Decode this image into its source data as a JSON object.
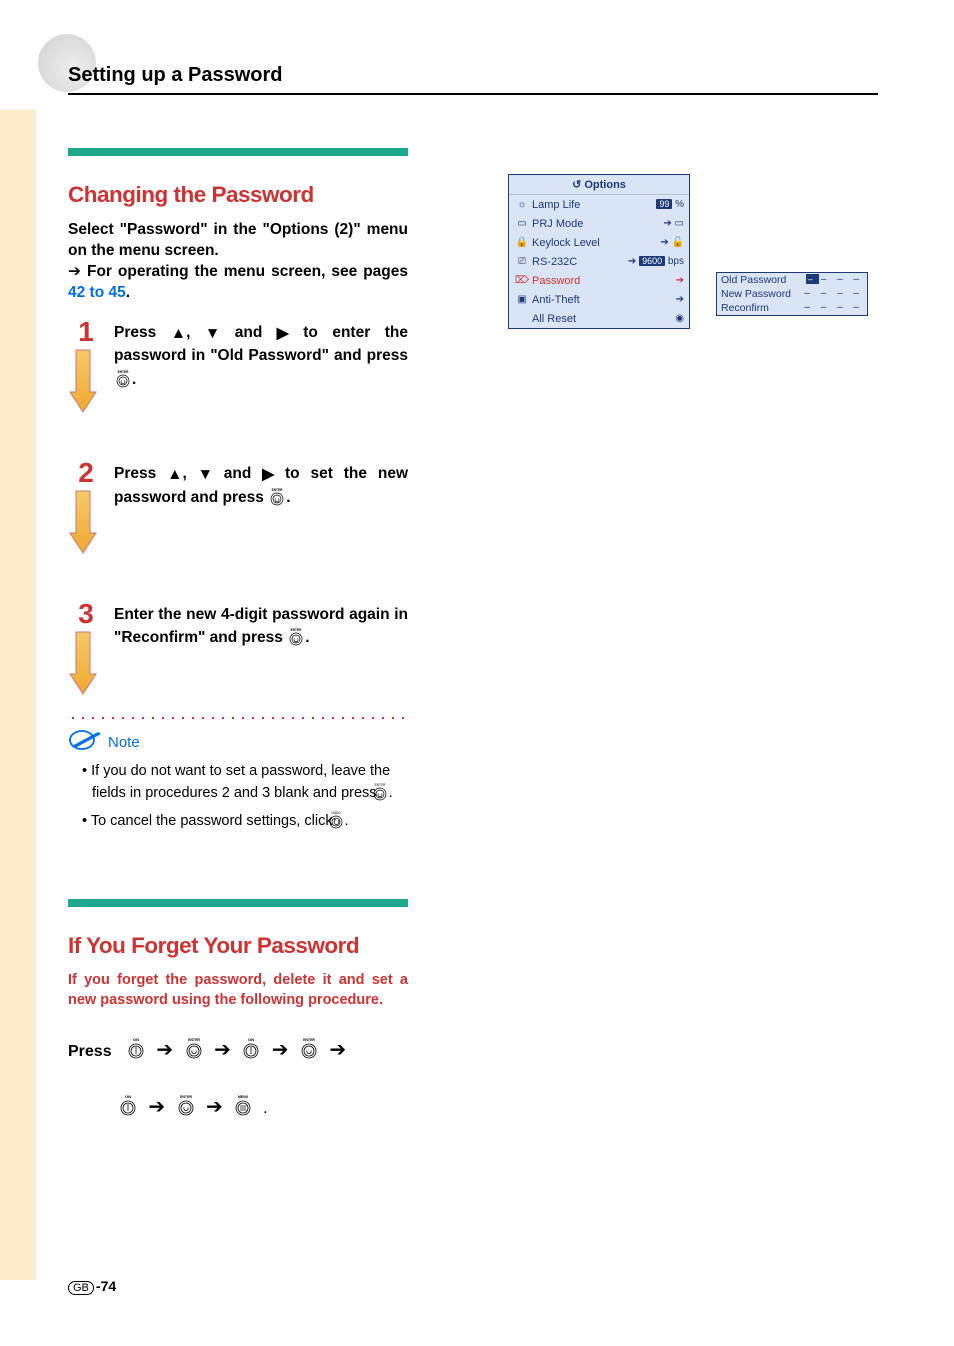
{
  "page_title": "Setting up a Password",
  "section1": {
    "title": "Changing the Password",
    "intro1a": "Select \"Password\" in the \"Options (2)\" menu on the menu screen.",
    "intro1b_pre": "For operating the menu screen, see pages ",
    "intro1b_link": "42 to 45",
    "intro1b_post": ".",
    "step1_a": "Press ",
    "step1_b": ", ",
    "step1_c": " and ",
    "step1_d": " to enter the password in \"Old Password\" and press ",
    "step1_e": ".",
    "step2_a": "Press ",
    "step2_b": ", ",
    "step2_c": " and ",
    "step2_d": " to set the new password and press ",
    "step2_e": ".",
    "step3_a": "Enter the new 4-digit password again in \"Reconfirm\" and press ",
    "step3_b": "."
  },
  "note": {
    "label": "Note",
    "item1_a": "If you do not want to set a password, leave the fields in procedures 2 and 3 blank and press ",
    "item1_b": ".",
    "item2_a": "To cancel the password settings, click ",
    "item2_b": "."
  },
  "section2": {
    "title": "If You Forget Your Password",
    "intro": "If you forget the password, delete it and set a new password using the following procedure.",
    "press_label": "Press"
  },
  "options_menu": {
    "title": "Options",
    "rows": [
      {
        "icon": "☼",
        "label": "Lamp Life",
        "val_badge": "99",
        "val_suffix": " %"
      },
      {
        "icon": "▭",
        "label": "PRJ Mode",
        "val_prefix": "➔",
        "val_icon": "▭"
      },
      {
        "icon": "🔒",
        "label": "Keylock Level",
        "val_prefix": "➔",
        "val_icon": "🔓"
      },
      {
        "icon": "⎚",
        "label": "RS-232C",
        "val_prefix": "➔",
        "val_badge": "9600",
        "val_suffix": " bps"
      },
      {
        "icon": "⌦",
        "label": "Password",
        "val_icon": "➔",
        "selected": true
      },
      {
        "icon": "▣",
        "label": "Anti-Theft",
        "val_icon": "➔"
      },
      {
        "icon": "",
        "label": "All Reset",
        "val_icon": "◉"
      }
    ]
  },
  "password_panel": {
    "rows": [
      {
        "label": "Old Password",
        "cursor": true,
        "val": "– – –"
      },
      {
        "label": "New Password",
        "val": "– – – –"
      },
      {
        "label": "Reconfirm",
        "val": "– – – –"
      }
    ]
  },
  "page_num": "-74",
  "region": "GB",
  "buttons": {
    "enter": "ENTER",
    "undo": "UNDO",
    "on": "ON",
    "menu": "MENU"
  }
}
